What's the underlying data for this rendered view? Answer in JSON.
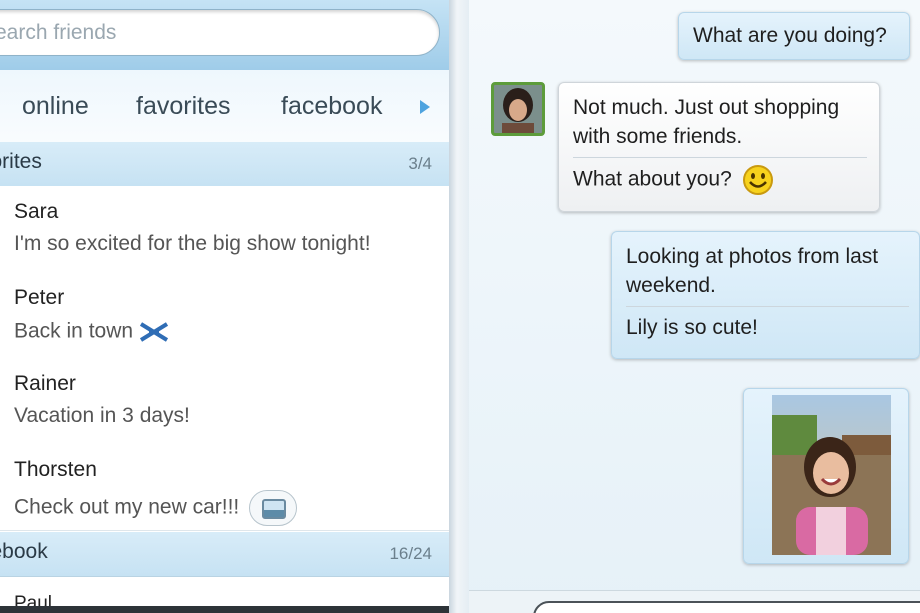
{
  "search": {
    "placeholder": "earch friends"
  },
  "tabs": [
    {
      "label": "online"
    },
    {
      "label": "favorites"
    },
    {
      "label": "facebook"
    }
  ],
  "sections": {
    "favorites": {
      "title": "vorites",
      "count": "3/4"
    },
    "facebook": {
      "title": "cebook",
      "count": "16/24"
    }
  },
  "friends": [
    {
      "name": "Sara",
      "status": "I'm so excited for the big show tonight!"
    },
    {
      "name": "Peter",
      "status": "Back in town",
      "status_icon": "airplane-icon"
    },
    {
      "name": "Rainer",
      "status": "Vacation in 3 days!"
    },
    {
      "name": "Thorsten",
      "status": "Check out my new car!!!",
      "status_icon": "photo-icon"
    }
  ],
  "facebook_friends": [
    {
      "name": "Paul"
    }
  ],
  "chat": {
    "messages": [
      {
        "direction": "out",
        "lines": [
          "What are you doing?"
        ]
      },
      {
        "direction": "in",
        "lines": [
          "Not much. Just out shopping with some friends.",
          "What about you?"
        ],
        "emoticon": "smiley-icon"
      },
      {
        "direction": "out",
        "lines": [
          "Looking at photos from last weekend.",
          "Lily is so cute!"
        ]
      },
      {
        "direction": "out",
        "attachment": "photo-attachment"
      }
    ]
  },
  "colors": {
    "accent": "#4ea3df",
    "header": "#9fcce9",
    "avatar_border": "#5d9c3b"
  }
}
